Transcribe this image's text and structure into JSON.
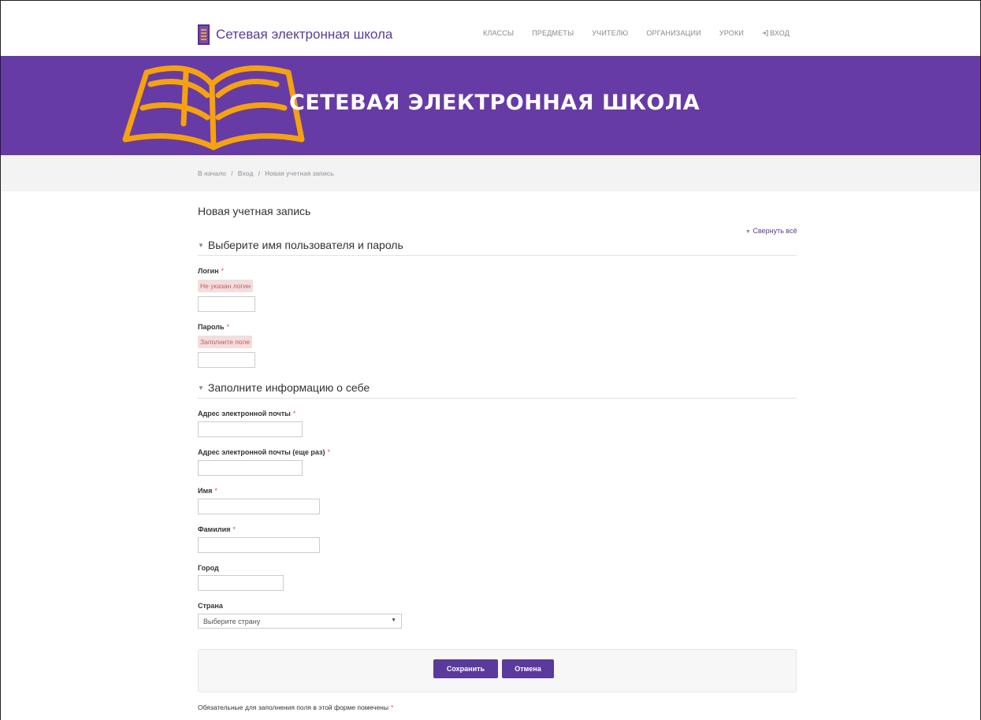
{
  "header": {
    "site_title": "Сетевая электронная школа",
    "nav": [
      "КЛАССЫ",
      "ПРЕДМЕТЫ",
      "УЧИТЕЛЮ",
      "ОРГАНИЗАЦИИ",
      "УРОКИ"
    ],
    "login_label": "ВХОД",
    "login_icon": "sign-in-icon"
  },
  "banner": {
    "title": "СЕТЕВАЯ ЭЛЕКТРОННАЯ ШКОЛА",
    "book_color": "#f6a20e",
    "background": "#673ba5"
  },
  "breadcrumb": [
    "В начало",
    "Вход",
    "Новая учетная запись"
  ],
  "breadcrumb_separator": "/",
  "page": {
    "title": "Новая учетная запись",
    "collapse_all": "Свернуть всё"
  },
  "sections": {
    "credentials": "Выберите имя пользователя и пароль",
    "about": "Заполните информацию о себе"
  },
  "fields": {
    "login": {
      "label": "Логин",
      "error": "Не указан логин",
      "value": ""
    },
    "password": {
      "label": "Пароль",
      "error": "Заполните поле",
      "value": ""
    },
    "email": {
      "label": "Адрес электронной почты",
      "value": ""
    },
    "email2": {
      "label": "Адрес электронной почты (еще раз)",
      "value": ""
    },
    "firstname": {
      "label": "Имя",
      "value": ""
    },
    "lastname": {
      "label": "Фамилия",
      "value": ""
    },
    "city": {
      "label": "Город",
      "value": ""
    },
    "country": {
      "label": "Страна",
      "selected": "Выберите страну"
    }
  },
  "required_marker": "*",
  "buttons": {
    "save": "Сохранить",
    "cancel": "Отмена"
  },
  "footnote": "Обязательные для заполнения поля в этой форме помечены",
  "colors": {
    "accent": "#5a3a9c",
    "error_bg": "#f2dede",
    "required": "#d9534f"
  }
}
